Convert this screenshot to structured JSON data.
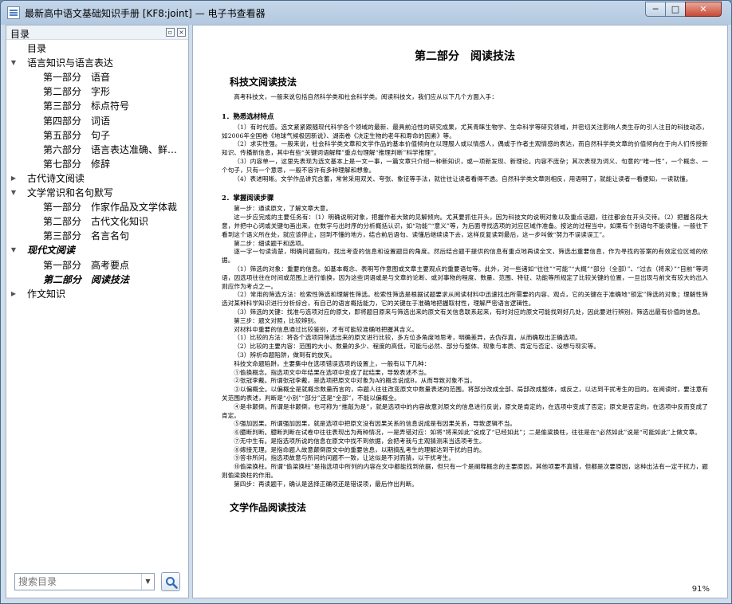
{
  "window": {
    "title": "最新高中语文基础知识手册 [KF8:joint] — 电子书查看器",
    "min_label": "─",
    "max_label": "□",
    "close_label": "✕"
  },
  "sidebar": {
    "header": "目录",
    "float_label": "▫",
    "close_label": "×",
    "items": [
      {
        "level": 0,
        "toggle": "",
        "label": "目录"
      },
      {
        "level": 0,
        "toggle": "▼",
        "label": "语言知识与语言表达"
      },
      {
        "level": 1,
        "a": "第一部分",
        "b": "语音"
      },
      {
        "level": 1,
        "a": "第二部分",
        "b": "字形"
      },
      {
        "level": 1,
        "a": "第三部分",
        "b": "标点符号"
      },
      {
        "level": 1,
        "a": "第四部分",
        "b": "词语"
      },
      {
        "level": 1,
        "a": "第五部分",
        "b": "句子"
      },
      {
        "level": 1,
        "a": "第六部分",
        "b": "语言表达准确、鲜…"
      },
      {
        "level": 1,
        "a": "第七部分",
        "b": "修辞"
      },
      {
        "level": 0,
        "toggle": "▶",
        "label": "古代诗文阅读"
      },
      {
        "level": 0,
        "toggle": "▼",
        "label": "文学常识和名句默写"
      },
      {
        "level": 1,
        "a": "第一部分",
        "b": "作家作品及文学体裁"
      },
      {
        "level": 1,
        "a": "第二部分",
        "b": "古代文化知识"
      },
      {
        "level": 1,
        "a": "第三部分",
        "b": "名言名句"
      },
      {
        "level": 0,
        "toggle": "▼",
        "label": "现代文阅读",
        "style": "italic-bold"
      },
      {
        "level": 1,
        "a": "第一部分",
        "b": "高考要点"
      },
      {
        "level": 1,
        "a": "第二部分",
        "b": "阅读技法",
        "style": "italic-bold"
      },
      {
        "level": 0,
        "toggle": "▶",
        "label": "作文知识"
      }
    ],
    "search_placeholder": "搜索目录",
    "dropdown_icon": "▼"
  },
  "doc": {
    "title": "第二部分　阅读技法",
    "section1": "科技文阅读技法",
    "intro": "高考科技文，一般来说包括自然科学类和社会科学类。阅读科技文，我们应从以下几个方面入手：",
    "h_1": "1．熟悉选材特点",
    "p_1": [
      "（1）有时代感。选文紧紧跟随现代科学各个领域的最新、最具前沿性的研究成果，尤其青睐生物学、生命科学等研究领域，并密切关注影响人类生存的引人注目的科技动态，如2006年全国卷《地球气候极因新说》、湖南卷《决定生物的老年和寿命的因素》等。",
      "（2）求实性强。一般来说，社会科学类文章和文学作品的基本价值倾向在以理服人或以情感人，偶或于作者主观情感的表达，而自然科学类文章的价值倾向在于向人们传授新知识、传播新信息，其中有些“关键词语解释”重点句理解“推理判断”科学推理”。",
      "（3）内容单一，这里先表现为选文基本上是一文一事，一篇文章只介绍一种新知识，或一项新发现、新理论。内容不庞杂；其次表现为词义、句意的“唯一性”，一个概念、一个句子，只有一个意思，一般不容许有多种理解和想象。",
      "（4）表述明晰。文学作品讲究含蓄，常常采用双关、夸张、象征等手法，就往往让读者看得不透。自然科学类文章则相反，用语明了，就能让读者一看便知，一读就懂。"
    ],
    "h_2": "2．掌握阅读步骤",
    "p_2": [
      "第一步：通读原文，了解文章大意。",
      "这一步应完成的主要任务有：（1）明确说明对象，把握作者大致的见解倾向。尤其要抓住开头，因为科技文的说明对象以及重点话题，往往都会在开头交待。（2）把握各段大意，并把中心词或关键句画出来，在数字与出时序的分析概括认识，如“功能”“意义”等，为后面寻找选项的对应区域作准备。按这的过程当中，如果有个别语句不能读懂，一般往下看到这个语义所在处，就应该停止，回到不懂的地方，结合前后语句、读懂后继续读下去，这样反复读到最后，这一步叫做“努力不误读误工”。",
      "第二步：细读题干和选项。",
      "逐一字一句读清楚，明确问题指向，找出考查的信息和设置题目的角度。然后结合题干提供的信息有重点地再读全文，筛选出重要信息，作为寻找的答案的有效定位区域的依据。",
      "（1）筛选的对象：重要的信息。如基本概念、表明写作意图或文章主要观点的重要语句等。此外，对一些诸如“往往”“可能”“大概”“部分（全部）”、“过去（将来）”“目前”等词语，因选项往往在时间或范围上进行偷换，因为这些词语或是与文章的论断、或对事物的程度、数量、范围、特征、功能等所规定了比较关键的位置，一旦出现与前文有较大的出入则应作为考点之一。",
      "（2）常用的筛选方法：检索性筛选和理解性筛选。检索性筛选是根据试题要求从阅读材料中迅速找出所需要的内容、观点，它的关键在于准确地“锁定”筛选的对象；理解性筛选对某种科学知识进行分析综合，有自己的语言概括能力，它的关键在于准确地把握取材性，理解严密语言逻辑性。",
      "（3）筛选的关键：找准与选项对应的原文，即将题目原来与筛选出来的原文有关信息联系起来，有时对应的原文可能找到好几处，因此要进行辨别，筛选出最有价值的信息。",
      "第三步：题文对照，比较辨别。",
      "对材料中重要的信息通过比较鉴别，才有可能较准确地把握其含义。",
      "（1）比较的方法：将各个选项同筛选出来的原文进行比较，多方位多角度地思考，明确差异，去伪存真，从而确取出正确选项。",
      "（2）比较的主要内容：范围的大小、数量的多少、程度的高低，可能与必然、部分与整体、现象与本质、肯定与否定、设想与现实等。",
      "（3）辨析命题陷阱，做到有的放矢。",
      "科技文命题陷阱，主要集中在选项错误选项的设置上，一般有以下几种：",
      "①偷换概念。指选项文中年结果在选项中变成了起结果，导致表述不当。",
      "②张冠李戴。所谓张冠李戴，是选项把原文中对象为A的概念说成B，从而导致对象不当。",
      "③以偏概全。以偏概全是就概念数量而言的，命题人往往改变原文中数量表述的范围。将部分改成全部、局部改成整体，或反之，以达到干扰考生的目的。在阅读时，要注意有关范围的表述，判断是“小别”“部分”还是“全部”，不能以偏概全。",
      "④是非颠倒。所谓是非颠倒，也可称为“推敲为是”，就是选项中的内容故意对原文的信息进行反说，原文是肯定的，在选项中变成了否定；原文是否定的，在选项中反而变成了肯定。",
      "⑤强加因果。所谓强加因果，就是选项中把原文没有因果关系的信息说成是有因果关系，导致逻辑不当。",
      "⑥臆断判断。臆断判断在试卷中往往表现出为两种情况，一是弄错对应：如将“将来如此”说成了“已经如此”；二是偷梁换柱，往往是在“必然如此”说是“可能如此”上做文章。",
      "⑦无中生有。是指选项所说的信息在原文中找不到依据，会把考我与主观猜测来当选项考生。",
      "⑧嫁接无理。是指命题人故意颠倒原文中的重要信息，以期搞乱考生的理解达到干扰的目的。",
      "⑨答非所问。指选项故意与所问的问题不一致，让这似是不对而猜，以干扰考生。",
      "⑩偷梁换柱。所谓“偷梁换柱”是指选项中所列的内容在文中都能找到依据，但只有一个是阐释概念的主要原因，其他项要不真错，但都是次要原因，这种出法有一定干扰力，题则偷梁换柱的作用。",
      "第四步：再读题干，确认是选择正确项还是错误项，最后作出判断。"
    ],
    "section2": "文学作品阅读技法"
  },
  "status": {
    "zoom": "91%"
  }
}
